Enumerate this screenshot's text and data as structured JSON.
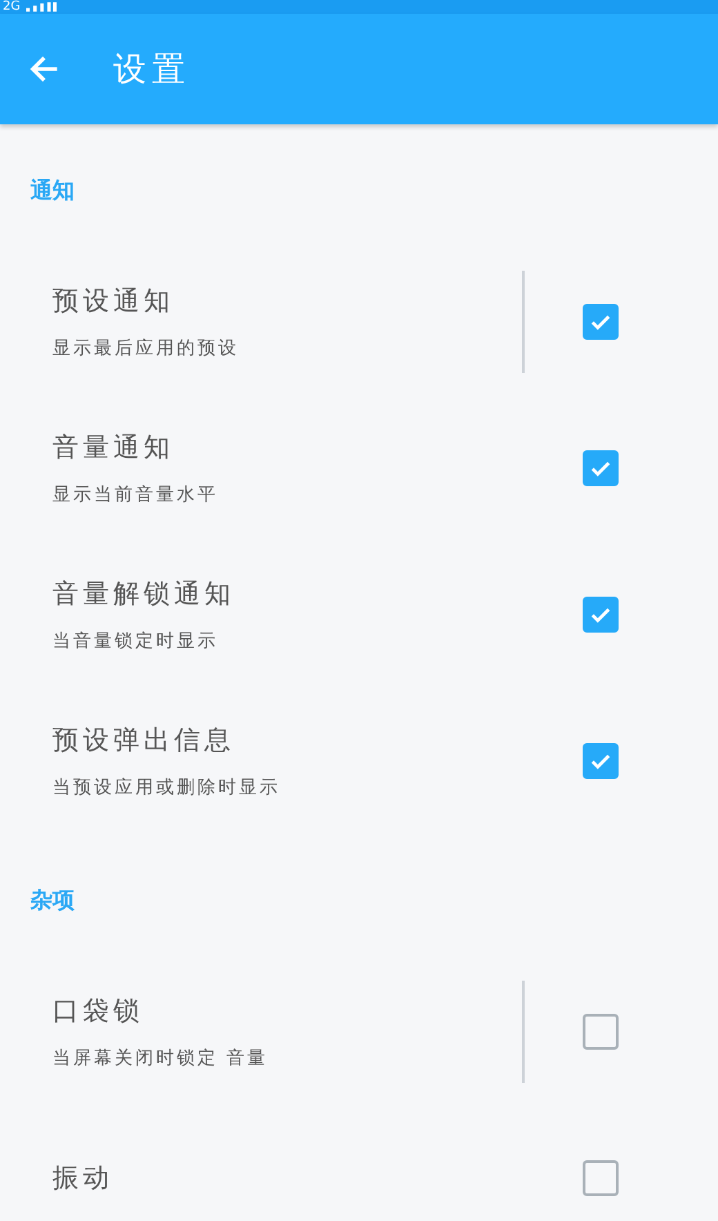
{
  "status_bar": {
    "network": "2G"
  },
  "app_bar": {
    "title": "设置"
  },
  "sections": [
    {
      "title": "通知",
      "items": [
        {
          "title": "预设通知",
          "subtitle": "显示最后应用的预设",
          "checked": true,
          "divider": true
        },
        {
          "title": "音量通知",
          "subtitle": "显示当前音量水平",
          "checked": true,
          "divider": false
        },
        {
          "title": "音量解锁通知",
          "subtitle": "当音量锁定时显示",
          "checked": true,
          "divider": false
        },
        {
          "title": "预设弹出信息",
          "subtitle": "当预设应用或删除时显示",
          "checked": true,
          "divider": false
        }
      ]
    },
    {
      "title": "杂项",
      "items": [
        {
          "title": "口袋锁",
          "subtitle": "当屏幕关闭时锁定 音量",
          "checked": false,
          "divider": true
        },
        {
          "title": "振动",
          "checked": false,
          "divider": false
        }
      ]
    }
  ]
}
